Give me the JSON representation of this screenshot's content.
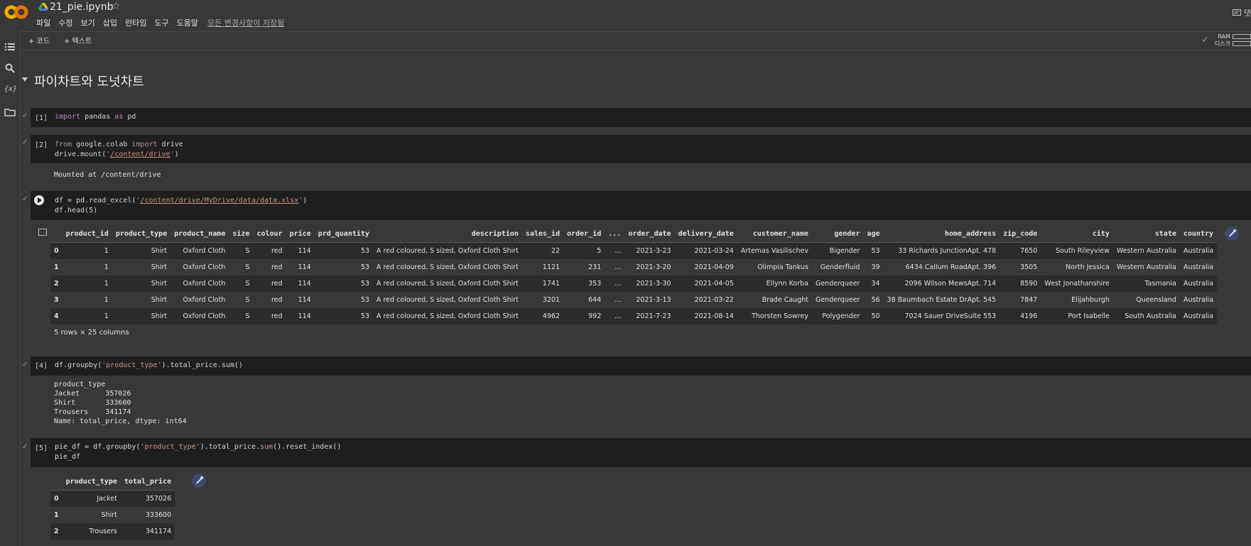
{
  "header": {
    "file_title": "21_pie.ipynb",
    "menu": [
      "파일",
      "수정",
      "보기",
      "삽입",
      "런타임",
      "도구",
      "도움말"
    ],
    "saved_status": "모든 변경사항이 저장됨",
    "comment_label": "댓"
  },
  "toolbar": {
    "add_code": "+ 코드",
    "add_text": "+ 텍스트",
    "ram_label": "RAM",
    "disk_label": "디스크"
  },
  "leftrail": {
    "variables_label": "{x}"
  },
  "section": {
    "title": "파이차트와 도넛차트"
  },
  "cells": {
    "c1": {
      "count": "[1]"
    },
    "c2": {
      "count": "[2]",
      "output": "Mounted at /content/drive"
    },
    "c3": {
      "rows_info": "5 rows × 25 columns"
    },
    "c4": {
      "count": "[4]",
      "output": "product_type\nJacket      357026\nShirt       333600\nTrousers    341174\nName: total_price, dtype: int64"
    },
    "c5": {
      "count": "[5]"
    }
  },
  "table1": {
    "columns": [
      "",
      "product_id",
      "product_type",
      "product_name",
      "size",
      "colour",
      "price",
      "prd_quantity",
      "description",
      "sales_id",
      "order_id",
      "...",
      "order_date",
      "delivery_date",
      "customer_name",
      "gender",
      "age",
      "home_address",
      "zip_code",
      "city",
      "state",
      "country"
    ],
    "rows": [
      [
        "0",
        "1",
        "Shirt",
        "Oxford Cloth",
        "S",
        "red",
        "114",
        "53",
        "A red coloured, S sized, Oxford Cloth Shirt",
        "22",
        "5",
        "...",
        "2021-3-23",
        "2021-03-24",
        "Artemas Vasilischev",
        "Bigender",
        "53",
        "33 Richards JunctionApt. 478",
        "7650",
        "South Rileyview",
        "Western Australia",
        "Australia"
      ],
      [
        "1",
        "1",
        "Shirt",
        "Oxford Cloth",
        "S",
        "red",
        "114",
        "53",
        "A red coloured, S sized, Oxford Cloth Shirt",
        "1121",
        "231",
        "...",
        "2021-3-20",
        "2021-04-09",
        "Olimpia Tankus",
        "Genderfluid",
        "39",
        "6434 Callum RoadApt. 396",
        "3505",
        "North Jessica",
        "Western Australia",
        "Australia"
      ],
      [
        "2",
        "1",
        "Shirt",
        "Oxford Cloth",
        "S",
        "red",
        "114",
        "53",
        "A red coloured, S sized, Oxford Cloth Shirt",
        "1741",
        "353",
        "...",
        "2021-3-30",
        "2021-04-05",
        "Ellynn Korba",
        "Genderqueer",
        "34",
        "2096 Wilson MewsApt. 714",
        "8590",
        "West Jonathanshire",
        "Tasmania",
        "Australia"
      ],
      [
        "3",
        "1",
        "Shirt",
        "Oxford Cloth",
        "S",
        "red",
        "114",
        "53",
        "A red coloured, S sized, Oxford Cloth Shirt",
        "3201",
        "644",
        "...",
        "2021-3-13",
        "2021-03-22",
        "Brade Caught",
        "Genderqueer",
        "56",
        "38 Baumbach Estate DrApt. 545",
        "7847",
        "Elijahburgh",
        "Queensland",
        "Australia"
      ],
      [
        "4",
        "1",
        "Shirt",
        "Oxford Cloth",
        "S",
        "red",
        "114",
        "53",
        "A red coloured, S sized, Oxford Cloth Shirt",
        "4962",
        "992",
        "...",
        "2021-7-23",
        "2021-08-14",
        "Thorsten Sowrey",
        "Polygender",
        "50",
        "7024 Sauer DriveSuite 553",
        "4196",
        "Port Isabelle",
        "South Australia",
        "Australia"
      ]
    ]
  },
  "table2": {
    "columns": [
      "",
      "product_type",
      "total_price"
    ],
    "rows": [
      [
        "0",
        "Jacket",
        "357026"
      ],
      [
        "1",
        "Shirt",
        "333600"
      ],
      [
        "2",
        "Trousers",
        "341174"
      ]
    ]
  },
  "colors": {
    "success": "#57bb8a",
    "keyword": "#c586c0",
    "string": "#ce9178"
  }
}
